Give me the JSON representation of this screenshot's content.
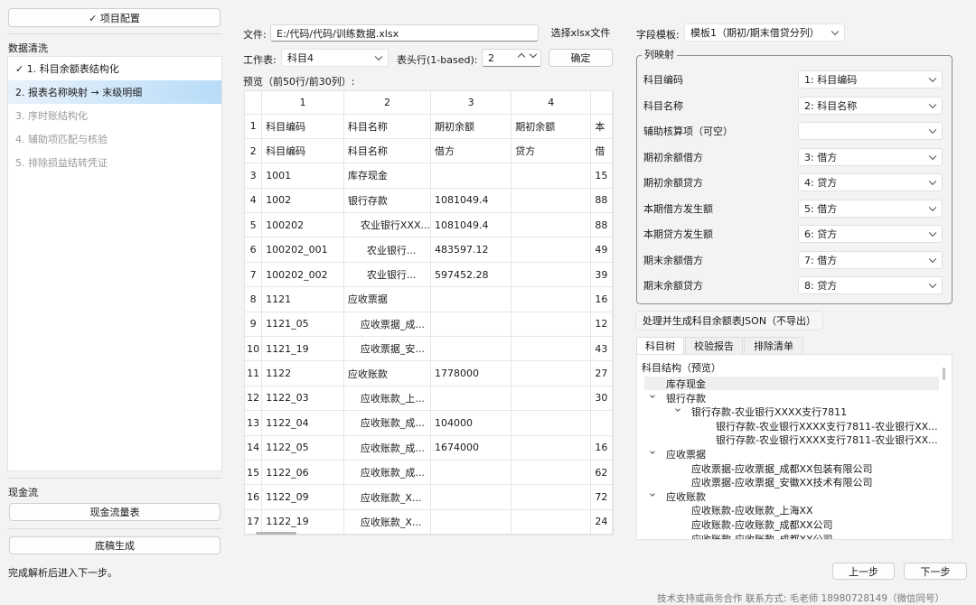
{
  "left": {
    "project_config": "✓ 项目配置",
    "section_clean": "数据清洗",
    "steps": [
      {
        "label": "✓ 1. 科目余额表结构化",
        "state": "done"
      },
      {
        "label": "2. 报表名称映射 → 末级明细",
        "state": "active"
      },
      {
        "label": "3. 序时账结构化",
        "state": "dim"
      },
      {
        "label": "4. 辅助项匹配与核验",
        "state": "dim"
      },
      {
        "label": "5. 排除损益结转凭证",
        "state": "dim"
      }
    ],
    "section_cash": "现金流",
    "cashflow_button": "现金流量表",
    "draft_button": "底稿生成"
  },
  "file": {
    "label": "文件:",
    "path": "E:/代码/代码/训练数据.xlsx",
    "choose_button": "选择xlsx文件"
  },
  "sheet": {
    "label": "工作表:",
    "value": "科目4",
    "header_label": "表头行(1-based):",
    "header_value": "2",
    "confirm_button": "确定"
  },
  "preview": {
    "label": "预览（前50行/前30列）:",
    "col_headers": [
      "1",
      "2",
      "3",
      "4",
      ""
    ],
    "rows": [
      [
        "1",
        "科目编码",
        "科目名称",
        "期初余额",
        "期初余额",
        "本"
      ],
      [
        "2",
        "科目编码",
        "科目名称",
        "借方",
        "贷方",
        "借"
      ],
      [
        "3",
        "1001",
        "库存现金",
        "",
        "",
        "15"
      ],
      [
        "4",
        "1002",
        "银行存款",
        "1081049.4",
        "",
        "88"
      ],
      [
        "5",
        "100202",
        "    农业银行XXX...",
        "1081049.4",
        "",
        "88"
      ],
      [
        "6",
        "100202_001",
        "      农业银行...",
        "483597.12",
        "",
        "49"
      ],
      [
        "7",
        "100202_002",
        "      农业银行...",
        "597452.28",
        "",
        "39"
      ],
      [
        "8",
        "1121",
        "应收票据",
        "",
        "",
        "16"
      ],
      [
        "9",
        "1121_05",
        "    应收票据_成...",
        "",
        "",
        "12"
      ],
      [
        "10",
        "1121_19",
        "    应收票据_安...",
        "",
        "",
        "43"
      ],
      [
        "11",
        "1122",
        "应收账款",
        "1778000",
        "",
        "27"
      ],
      [
        "12",
        "1122_03",
        "    应收账款_上...",
        "",
        "",
        "30"
      ],
      [
        "13",
        "1122_04",
        "    应收账款_成...",
        "104000",
        "",
        ""
      ],
      [
        "14",
        "1122_05",
        "    应收账款_成...",
        "1674000",
        "",
        "16"
      ],
      [
        "15",
        "1122_06",
        "    应收账款_成...",
        "",
        "",
        "62"
      ],
      [
        "16",
        "1122_09",
        "    应收账款_X...",
        "",
        "",
        "72"
      ],
      [
        "17",
        "1122_19",
        "    应收账款_X...",
        "",
        "",
        "24"
      ]
    ]
  },
  "template": {
    "label": "字段模板:",
    "value": "模板1（期初/期末借贷分列）"
  },
  "colmap": {
    "title": "列映射",
    "rows": [
      {
        "label": "科目编码",
        "value": "1: 科目编码"
      },
      {
        "label": "科目名称",
        "value": "2: 科目名称"
      },
      {
        "label": "辅助核算项（可空）",
        "value": ""
      },
      {
        "label": "期初余额借方",
        "value": "3: 借方"
      },
      {
        "label": "期初余额贷方",
        "value": "4: 贷方"
      },
      {
        "label": "本期借方发生额",
        "value": "5: 借方"
      },
      {
        "label": "本期贷方发生额",
        "value": "6: 贷方"
      },
      {
        "label": "期末余额借方",
        "value": "7: 借方"
      },
      {
        "label": "期末余额贷方",
        "value": "8: 贷方"
      }
    ]
  },
  "process_button": "处理并生成科目余额表JSON（不导出）",
  "tabs": [
    "科目树",
    "校验报告",
    "排除清单"
  ],
  "tree": {
    "title": "科目结构（预览）",
    "nodes": [
      {
        "text": "库存现金",
        "level": 1,
        "caret": false
      },
      {
        "text": "银行存款",
        "level": 1,
        "caret": true
      },
      {
        "text": "银行存款-农业银行XXXX支行7811",
        "level": 2,
        "caret": true
      },
      {
        "text": "银行存款-农业银行XXXX支行7811-农业银行XX...",
        "level": 3,
        "caret": false
      },
      {
        "text": "银行存款-农业银行XXXX支行7811-农业银行XX...",
        "level": 3,
        "caret": false
      },
      {
        "text": "应收票据",
        "level": 1,
        "caret": true
      },
      {
        "text": "应收票据-应收票据_成都XX包装有限公司",
        "level": 2,
        "caret": false
      },
      {
        "text": "应收票据-应收票据_安徽XX技术有限公司",
        "level": 2,
        "caret": false
      },
      {
        "text": "应收账款",
        "level": 1,
        "caret": true
      },
      {
        "text": "应收账款-应收账款_上海XX",
        "level": 2,
        "caret": false
      },
      {
        "text": "应收账款-应收账款_成都XX公司",
        "level": 2,
        "caret": false
      },
      {
        "text": "应收账款-应收账款_成都XX公司",
        "level": 2,
        "caret": false
      }
    ]
  },
  "footer": {
    "status": "完成解析后进入下一步。",
    "prev_button": "上一步",
    "next_button": "下一步",
    "support": "技术支持或商务合作 联系方式:  毛老师 18980728149（微信同号）"
  }
}
